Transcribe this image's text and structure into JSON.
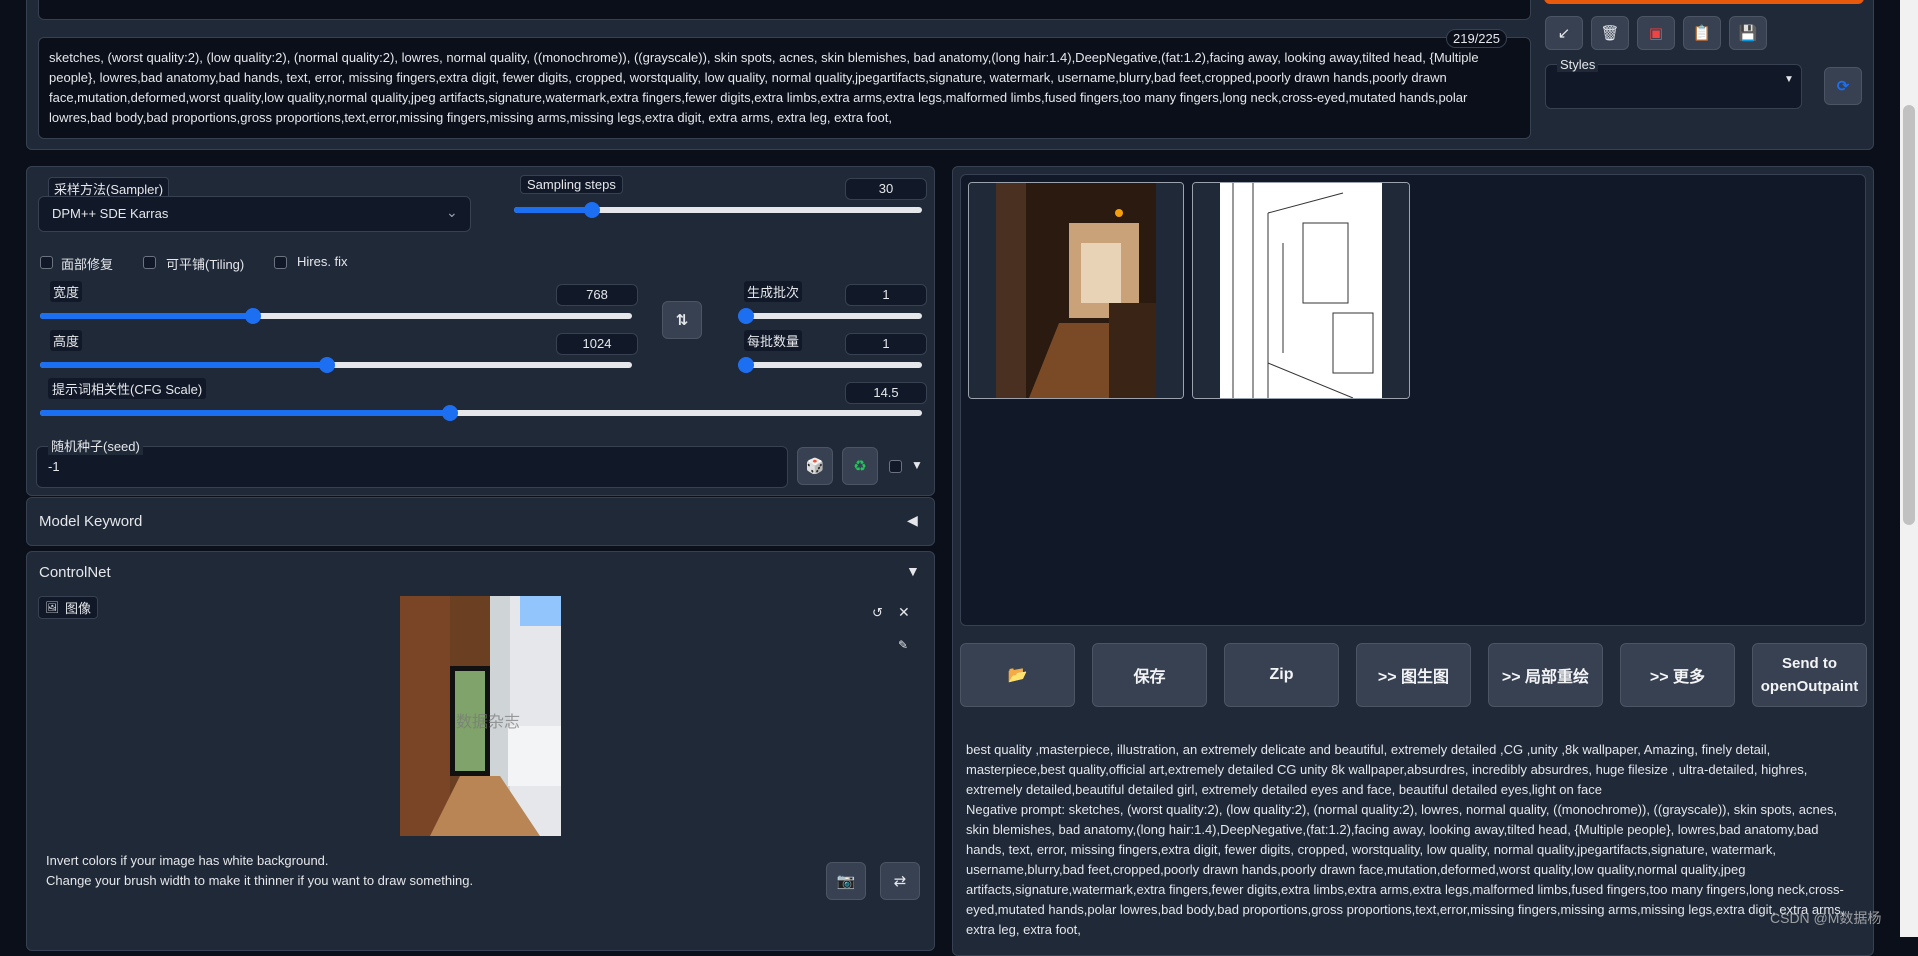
{
  "prompt_panel": {
    "token_counter": "219/225",
    "negative_prompt": "sketches, (worst quality:2), (low quality:2), (normal quality:2), lowres, normal quality, ((monochrome)), ((grayscale)), skin spots, acnes, skin blemishes, bad anatomy,(long hair:1.4),DeepNegative,(fat:1.2),facing away, looking away,tilted head, {Multiple people}, lowres,bad anatomy,bad hands, text, error, missing fingers,extra digit, fewer digits, cropped, worstquality, low quality, normal quality,jpegartifacts,signature, watermark, username,blurry,bad feet,cropped,poorly drawn hands,poorly drawn face,mutation,deformed,worst quality,low quality,normal quality,jpeg artifacts,signature,watermark,extra fingers,fewer digits,extra limbs,extra arms,extra legs,malformed limbs,fused fingers,too many fingers,long neck,cross-eyed,mutated hands,polar lowres,bad body,bad proportions,gross proportions,text,error,missing fingers,missing arms,missing legs,extra digit, extra arms, extra leg, extra foot,"
  },
  "toolbar_icons": [
    "pencil-icon",
    "trash-icon",
    "red-card-icon",
    "clipboard-icon",
    "save-icon"
  ],
  "styles": {
    "label": "Styles",
    "value": ""
  },
  "sampler": {
    "label": "采样方法(Sampler)",
    "value": "DPM++ SDE Karras"
  },
  "sampling_steps": {
    "label": "Sampling steps",
    "value": "30",
    "fraction": 0.19
  },
  "checkboxes": {
    "restore_faces": "面部修复",
    "tiling": "可平铺(Tiling)",
    "hires_fix": "Hires. fix"
  },
  "width": {
    "label": "宽度",
    "value": "768",
    "fraction": 0.36
  },
  "height": {
    "label": "高度",
    "value": "1024",
    "fraction": 0.485
  },
  "batch_count": {
    "label": "生成批次",
    "value": "1",
    "fraction": 0.0
  },
  "batch_size": {
    "label": "每批数量",
    "value": "1",
    "fraction": 0.0
  },
  "cfg_scale": {
    "label": "提示词相关性(CFG Scale)",
    "value": "14.5",
    "fraction": 0.465
  },
  "seed": {
    "label": "随机种子(seed)",
    "value": "-1"
  },
  "model_keyword": {
    "label": "Model Keyword",
    "arrow": "◀"
  },
  "controlnet": {
    "label": "ControlNet",
    "arrow": "▼",
    "image_tab": "图像",
    "hint1": "Invert colors if your image has white background.",
    "hint2": "Change your brush width to make it thinner if you want to draw something.",
    "watermark": "数据杂志"
  },
  "output_buttons": {
    "folder": "📂",
    "save": "保存",
    "zip": "Zip",
    "img2img": ">> 图生图",
    "inpaint": ">> 局部重绘",
    "extras": ">> 更多",
    "send_to_outpaint": "Send to openOutpaint"
  },
  "generation_info": {
    "positive": "best quality ,masterpiece, illustration, an extremely delicate and beautiful, extremely detailed ,CG ,unity ,8k wallpaper, Amazing, finely detail, masterpiece,best quality,official art,extremely detailed CG unity 8k wallpaper,absurdres, incredibly absurdres, huge filesize , ultra-detailed, highres, extremely detailed,beautiful detailed girl, extremely detailed eyes and face, beautiful detailed eyes,light on face",
    "negative": "Negative prompt: sketches, (worst quality:2), (low quality:2), (normal quality:2), lowres, normal quality, ((monochrome)), ((grayscale)), skin spots, acnes, skin blemishes, bad anatomy,(long hair:1.4),DeepNegative,(fat:1.2),facing away, looking away,tilted head, {Multiple people}, lowres,bad anatomy,bad hands, text, error, missing fingers,extra digit, fewer digits, cropped, worstquality, low quality, normal quality,jpegartifacts,signature, watermark, username,blurry,bad feet,cropped,poorly drawn hands,poorly drawn face,mutation,deformed,worst quality,low quality,normal quality,jpeg artifacts,signature,watermark,extra fingers,fewer digits,extra limbs,extra arms,extra legs,malformed limbs,fused fingers,too many fingers,long neck,cross-eyed,mutated hands,polar lowres,bad body,bad proportions,gross proportions,text,error,missing fingers,missing arms,missing legs,extra digit, extra arms, extra leg, extra foot,"
  },
  "corner_watermark": "CSDN @M数据杨",
  "colors": {
    "accent": "#1d6ff2",
    "background": "#0b0f19",
    "panel": "#1f2937",
    "generate_button": "#e8590c"
  }
}
